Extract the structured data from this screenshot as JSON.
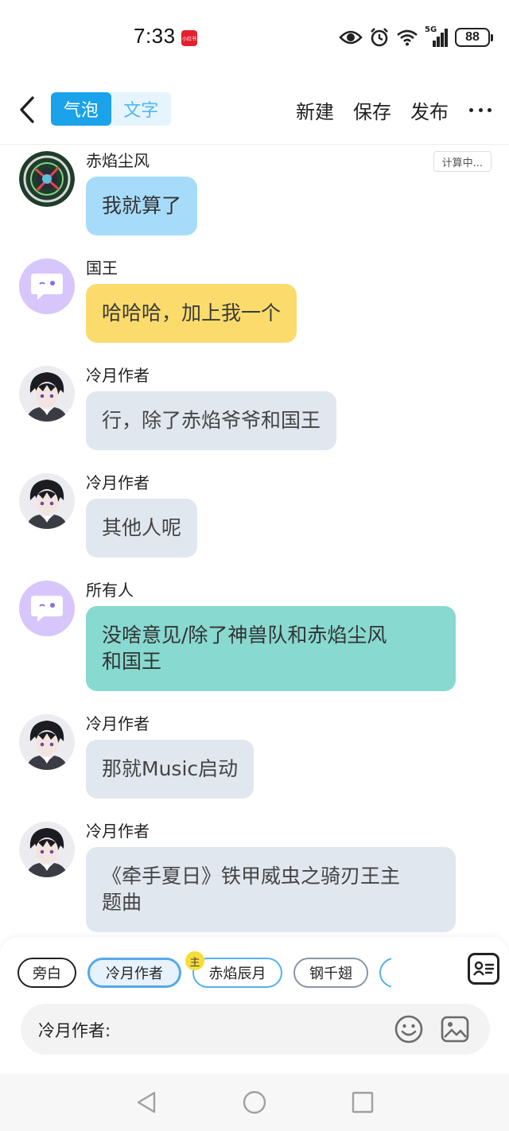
{
  "status_bar": {
    "time": "7:33",
    "app_badge": "小红书",
    "network": "5G",
    "battery": "88"
  },
  "header": {
    "tabs": [
      {
        "label": "气泡",
        "active": true
      },
      {
        "label": "文字",
        "active": false
      }
    ],
    "actions": [
      "新建",
      "保存",
      "发布"
    ]
  },
  "calc_badge": "计算中...",
  "messages": [
    {
      "sender": "赤焰尘风",
      "text": "我就算了",
      "style": "blue"
    },
    {
      "sender": "国王",
      "text": "哈哈哈，加上我一个",
      "style": "yellow"
    },
    {
      "sender": "冷月作者",
      "text": "行，除了赤焰爷爷和国王",
      "style": "gray"
    },
    {
      "sender": "冷月作者",
      "text": "其他人呢",
      "style": "gray"
    },
    {
      "sender": "所有人",
      "text_line1": "没啥意见/除了神兽队和赤焰尘风",
      "text_line2": "和国王",
      "style": "teal"
    },
    {
      "sender": "冷月作者",
      "text": "那就Music启动",
      "style": "gray"
    },
    {
      "sender": "冷月作者",
      "text_line1": "《牵手夏日》铁甲威虫之骑刃王主",
      "text_line2": "题曲",
      "style": "gray"
    }
  ],
  "composer": {
    "chips": [
      "旁白",
      "冷月作者",
      "赤焰辰月",
      "钢千翅"
    ],
    "main_badge": "主",
    "input_label": "冷月作者:"
  },
  "colors": {
    "accent": "#1aa2ea",
    "bubble_blue": "#a6dcfa",
    "bubble_yellow": "#fbdb6b",
    "bubble_gray": "#e1e7ef",
    "bubble_teal": "#88d9d0",
    "default_avatar": "#d7c6fb"
  },
  "icons": [
    "back-arrow-icon",
    "more-icon",
    "eye-icon",
    "alarm-icon",
    "wifi-icon",
    "signal-icon",
    "battery-icon",
    "roster-icon",
    "emoji-icon",
    "image-icon",
    "nav-back-icon",
    "nav-home-icon",
    "nav-recent-icon"
  ]
}
